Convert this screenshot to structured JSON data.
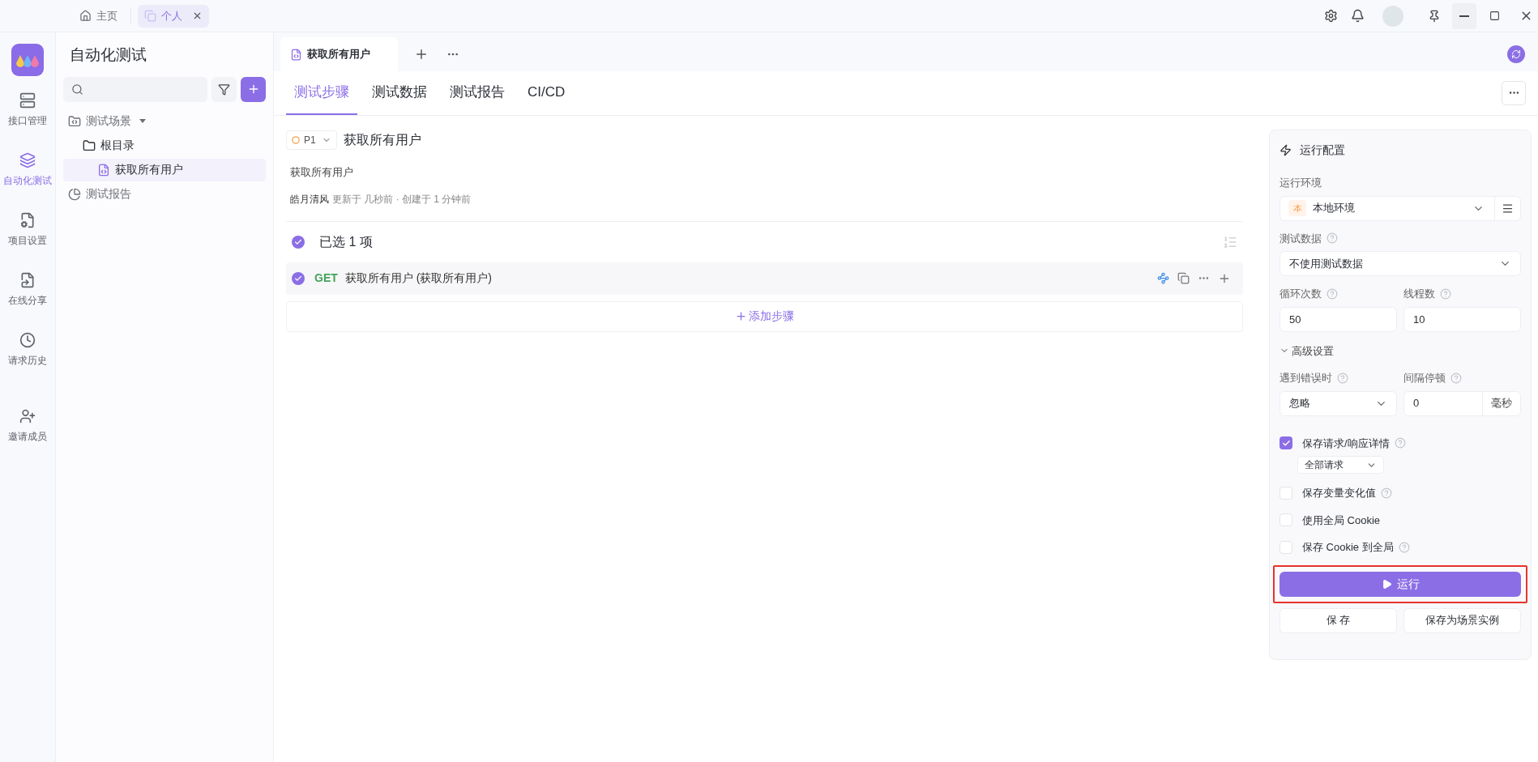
{
  "titlebar": {
    "tabs": [
      {
        "label": "主页",
        "kind": "home",
        "selected": false
      },
      {
        "label": "个人",
        "kind": "workspace",
        "selected": true
      }
    ]
  },
  "nav": {
    "items": [
      {
        "label": "接口管理",
        "kind": "api",
        "selected": false
      },
      {
        "label": "自动化测试",
        "kind": "automation",
        "selected": true
      },
      {
        "label": "项目设置",
        "kind": "settings",
        "selected": false
      },
      {
        "label": "在线分享",
        "kind": "share",
        "selected": false
      },
      {
        "label": "请求历史",
        "kind": "history",
        "selected": false
      }
    ],
    "invite": "邀请成员"
  },
  "sidebar": {
    "title": "自动化测试",
    "tree": [
      {
        "label": "测试场景",
        "kind": "scenes",
        "expanded": true,
        "children": [
          {
            "label": "根目录",
            "kind": "folder",
            "children": [
              {
                "label": "获取所有用户",
                "kind": "scenario",
                "selected": true
              }
            ]
          }
        ]
      },
      {
        "label": "测试报告",
        "kind": "reports"
      }
    ]
  },
  "doc_tabs": [
    {
      "label": "获取所有用户"
    }
  ],
  "sub_tabs": [
    {
      "label": "测试步骤",
      "selected": true
    },
    {
      "label": "测试数据",
      "selected": false
    },
    {
      "label": "测试报告",
      "selected": false
    },
    {
      "label": "CI/CD",
      "selected": false
    }
  ],
  "scenario": {
    "priority": "P1",
    "name": "获取所有用户",
    "description": "获取所有用户",
    "author": "皓月清风",
    "meta": "更新于 几秒前 · 创建于 1 分钟前",
    "selection": {
      "label": "已选 1 项",
      "checked": true
    },
    "steps": [
      {
        "method": "GET",
        "name": "获取所有用户 (获取所有用户)",
        "checked": true
      }
    ],
    "add_step": "添加步骤"
  },
  "run_config": {
    "title": "运行配置",
    "environment": {
      "label": "运行环境",
      "badge": "本",
      "value": "本地环境"
    },
    "test_data": {
      "label": "测试数据",
      "value": "不使用测试数据"
    },
    "loops": {
      "label": "循环次数",
      "value": "50"
    },
    "threads": {
      "label": "线程数",
      "value": "10"
    },
    "advanced": {
      "label": "高级设置",
      "expanded": true
    },
    "on_error": {
      "label": "遇到错误时",
      "value": "忽略"
    },
    "interval": {
      "label": "间隔停顿",
      "value": "0",
      "unit": "毫秒"
    },
    "options": [
      {
        "label": "保存请求/响应详情",
        "checked": true,
        "help": true,
        "sub_select": "全部请求"
      },
      {
        "label": "保存变量变化值",
        "checked": false,
        "help": true
      },
      {
        "label": "使用全局 Cookie",
        "checked": false,
        "help": false
      },
      {
        "label": "保存 Cookie 到全局",
        "checked": false,
        "help": true
      }
    ],
    "run_button": {
      "label": "运行",
      "highlighted": true
    },
    "save": "保 存",
    "save_instance": "保存为场景实例"
  }
}
